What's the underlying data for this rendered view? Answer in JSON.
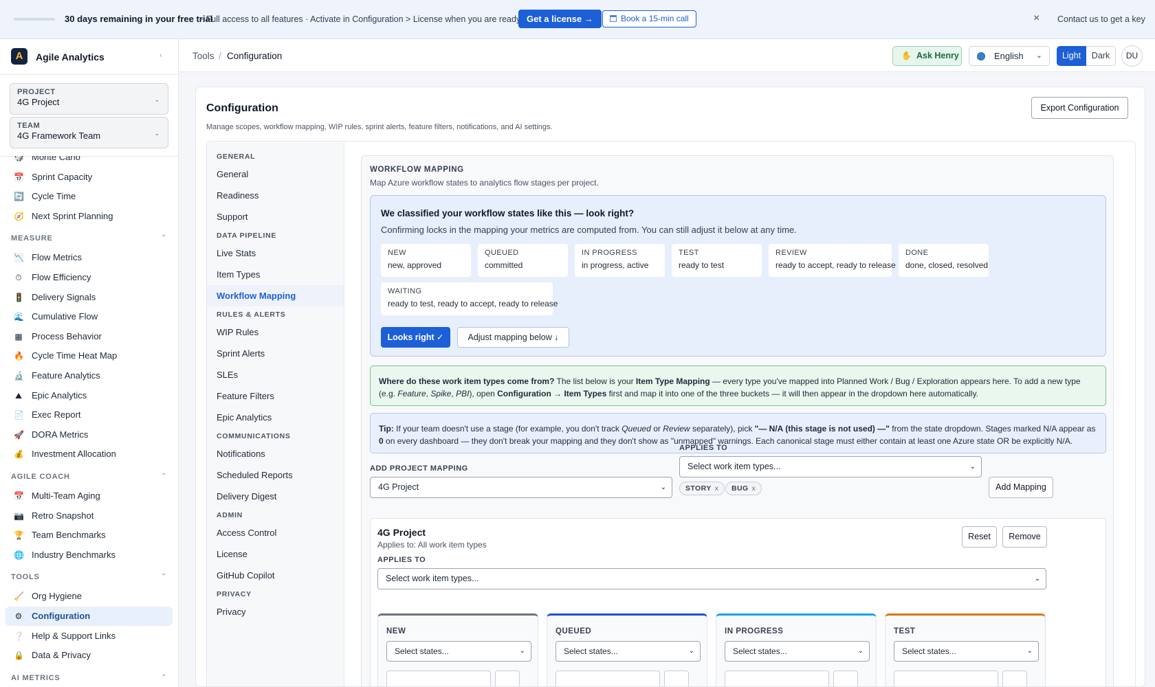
{
  "banner": {
    "trial_text": "30 days remaining in your free trial",
    "info_text": "· Full access to all features · Activate in Configuration > License when you are ready.",
    "license_button": "Get a license →",
    "call_button": "Book a 15-min call",
    "close_symbol": "×",
    "contact_text": "Contact us to get a key"
  },
  "sidebar": {
    "brand_letter": "A",
    "brand_name": "Agile Analytics",
    "collapse_symbol": "‹",
    "project_label": "PROJECT",
    "project_value": "4G Project",
    "team_label": "TEAM",
    "team_value": "4G Framework Team",
    "items": [
      {
        "label": "Monte Carlo",
        "icon": "dice-icon",
        "glyph": "🎲"
      },
      {
        "label": "Sprint Capacity",
        "icon": "calendar-icon",
        "glyph": "📅"
      },
      {
        "label": "Cycle Time",
        "icon": "refresh-icon",
        "glyph": "🔄"
      },
      {
        "label": "Next Sprint Planning",
        "icon": "compass-icon",
        "glyph": "🧭"
      },
      {
        "label": "MEASURE",
        "section": true
      },
      {
        "label": "Flow Metrics",
        "icon": "chart-icon",
        "glyph": "📉"
      },
      {
        "label": "Flow Efficiency",
        "icon": "stopwatch-icon",
        "glyph": "⏱"
      },
      {
        "label": "Delivery Signals",
        "icon": "traffic-light-icon",
        "glyph": "🚦"
      },
      {
        "label": "Cumulative Flow",
        "icon": "wave-icon",
        "glyph": "🌊"
      },
      {
        "label": "Process Behavior",
        "icon": "grid-icon",
        "glyph": "▦"
      },
      {
        "label": "Cycle Time Heat Map",
        "icon": "fire-icon",
        "glyph": "🔥"
      },
      {
        "label": "Feature Analytics",
        "icon": "microscope-icon",
        "glyph": "🔬"
      },
      {
        "label": "Epic Analytics",
        "icon": "mountain-icon",
        "glyph": "⛰"
      },
      {
        "label": "Exec Report",
        "icon": "report-icon",
        "glyph": "📄"
      },
      {
        "label": "DORA Metrics",
        "icon": "rocket-icon",
        "glyph": "🚀"
      },
      {
        "label": "Investment Allocation",
        "icon": "money-bag-icon",
        "glyph": "💰"
      },
      {
        "label": "AGILE COACH",
        "section": true
      },
      {
        "label": "Multi-Team Aging",
        "icon": "calendar-icon",
        "glyph": "📅"
      },
      {
        "label": "Retro Snapshot",
        "icon": "camera-icon",
        "glyph": "📷"
      },
      {
        "label": "Team Benchmarks",
        "icon": "trophy-icon",
        "glyph": "🏆"
      },
      {
        "label": "Industry Benchmarks",
        "icon": "globe-icon",
        "glyph": "🌐"
      },
      {
        "label": "TOOLS",
        "section": true
      },
      {
        "label": "Org Hygiene",
        "icon": "broom-icon",
        "glyph": "🧹"
      },
      {
        "label": "Configuration",
        "icon": "gear-icon",
        "glyph": "⚙",
        "active": true
      },
      {
        "label": "Help & Support Links",
        "icon": "question-icon",
        "glyph": "❔"
      },
      {
        "label": "Data & Privacy",
        "icon": "lock-icon",
        "glyph": "🔒"
      },
      {
        "label": "AI METRICS",
        "section": true
      }
    ]
  },
  "topbar": {
    "breadcrumb_root": "Tools",
    "breadcrumb_sep": "/",
    "breadcrumb_current": "Configuration",
    "ask_label": "Ask Henry",
    "language": "English",
    "theme_light": "Light",
    "theme_dark": "Dark",
    "avatar_initials": "DU"
  },
  "page": {
    "title": "Configuration",
    "description": "Manage scopes, workflow mapping, WIP rules, sprint alerts, feature filters, notifications, and AI settings.",
    "export_button": "Export Configuration"
  },
  "config_nav": [
    {
      "label": "GENERAL",
      "section": true
    },
    {
      "label": "General"
    },
    {
      "label": "Readiness"
    },
    {
      "label": "Support"
    },
    {
      "label": "DATA PIPELINE",
      "section": true
    },
    {
      "label": "Live Stats"
    },
    {
      "label": "Item Types"
    },
    {
      "label": "Workflow Mapping",
      "active": true
    },
    {
      "label": "RULES & ALERTS",
      "section": true
    },
    {
      "label": "WIP Rules"
    },
    {
      "label": "Sprint Alerts"
    },
    {
      "label": "SLEs"
    },
    {
      "label": "Feature Filters"
    },
    {
      "label": "Epic Analytics"
    },
    {
      "label": "COMMUNICATIONS",
      "section": true
    },
    {
      "label": "Notifications"
    },
    {
      "label": "Scheduled Reports"
    },
    {
      "label": "Delivery Digest"
    },
    {
      "label": "ADMIN",
      "section": true
    },
    {
      "label": "Access Control"
    },
    {
      "label": "License"
    },
    {
      "label": "GitHub Copilot"
    },
    {
      "label": "PRIVACY",
      "section": true
    },
    {
      "label": "Privacy"
    }
  ],
  "workflow": {
    "heading": "WORKFLOW MAPPING",
    "subtitle": "Map Azure workflow states to analytics flow stages per project.",
    "classify": {
      "question": "We classified your workflow states like this — look right?",
      "detail": "Confirming locks in the mapping your metrics are computed from. You can still adjust it below at any time.",
      "stages": [
        {
          "name": "NEW",
          "states": "new, approved"
        },
        {
          "name": "QUEUED",
          "states": "committed"
        },
        {
          "name": "IN PROGRESS",
          "states": "in progress, active"
        },
        {
          "name": "TEST",
          "states": "ready to test"
        },
        {
          "name": "REVIEW",
          "states": "ready to accept, ready to release"
        },
        {
          "name": "DONE",
          "states": "done, closed, resolved"
        },
        {
          "name": "WAITING",
          "states": "ready to test, ready to accept, ready to release"
        }
      ],
      "confirm_button": "Looks right ✓",
      "adjust_button": "Adjust mapping below ↓"
    },
    "where_html": "<b>Where do these work item types come from?</b> The list below is your <b>Item Type Mapping</b> — every type you've mapped into Planned Work / Bug / Exploration appears here. To add a new type (e.g. <i>Feature</i>, <i>Spike</i>, <i>PBI</i>), open <b>Configuration → Item Types</b> first and map it into one of the three buckets — it will then appear in the dropdown here automatically.",
    "tip_html": "<b>Tip:</b> If your team doesn't use a stage (for example, you don't track <i>Queued</i> or <i>Review</i> separately), pick <b>\"— N/A (this stage is not used) —\"</b> from the state dropdown. Stages marked N/A appear as <b>0</b> on every dashboard — they don't break your mapping and they don't show as \"unmapped\" warnings. Each canonical stage must either contain at least one Azure state OR be explicitly N/A.",
    "add_label": "ADD PROJECT MAPPING",
    "add_project": "4G Project",
    "applies_label": "APPLIES TO",
    "applies_placeholder": "Select work item types...",
    "chips": [
      "STORY",
      "BUG"
    ],
    "chip_remove": "x",
    "add_button": "Add Mapping",
    "project": {
      "name": "4G Project",
      "applies_text": "Applies to: All work item types",
      "reset_button": "Reset",
      "remove_button": "Remove",
      "applies_label": "APPLIES TO",
      "applies_placeholder": "Select work item types...",
      "columns": [
        {
          "name": "NEW",
          "color": "#6b7280",
          "placeholder": "Select states..."
        },
        {
          "name": "QUEUED",
          "color": "#1d4ed8",
          "placeholder": "Select states..."
        },
        {
          "name": "IN PROGRESS",
          "color": "#0ea5e9",
          "placeholder": "Select states..."
        },
        {
          "name": "TEST",
          "color": "#d97706",
          "placeholder": "Select states..."
        }
      ]
    }
  }
}
